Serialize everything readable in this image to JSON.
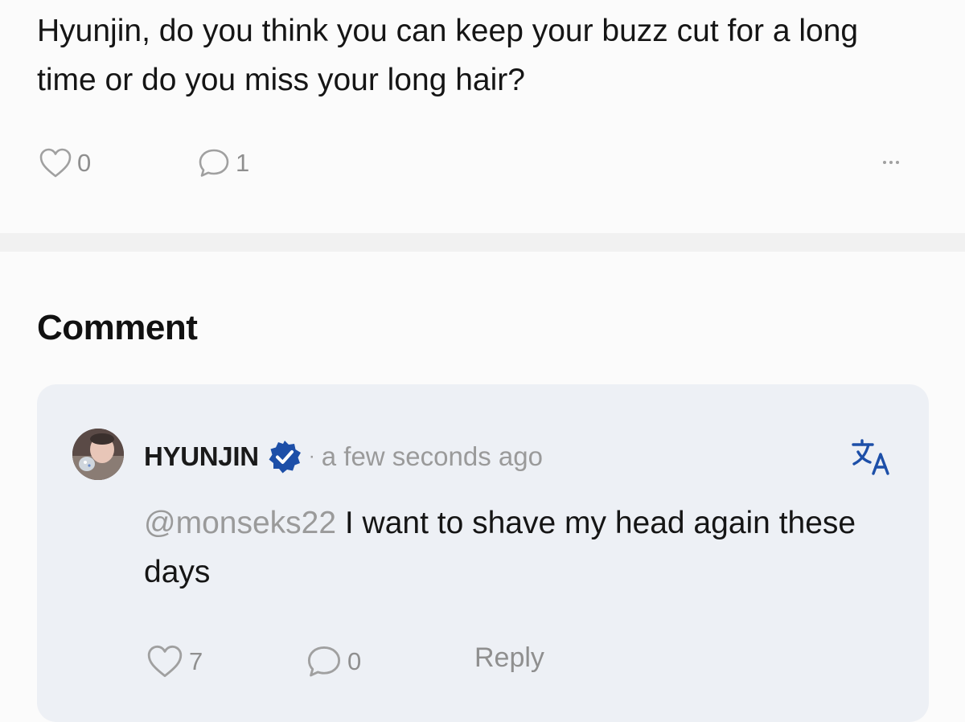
{
  "post": {
    "text": "Hyunjin, do you think you can keep your buzz cut for a long time or do you miss your long hair?",
    "like_count": "0",
    "comment_count": "1"
  },
  "comments_section": {
    "title": "Comment"
  },
  "comment": {
    "author": "HYUNJIN",
    "separator": "·",
    "time": "a few seconds ago",
    "mention": "@monseks22",
    "text": " I want to shave my head again these days",
    "like_count": "7",
    "reply_count": "0",
    "reply_label": "Reply"
  },
  "icons": {
    "post_like": "heart-icon",
    "post_comment": "comment-bubble-icon",
    "more": "more-horizontal-icon",
    "verified": "verified-badge-icon",
    "translate": "translate-icon"
  },
  "colors": {
    "verified_badge": "#1d4fa8",
    "translate_icon": "#1d4fa8",
    "muted_text": "#9a9a9a",
    "card_background": "#edf0f5"
  }
}
